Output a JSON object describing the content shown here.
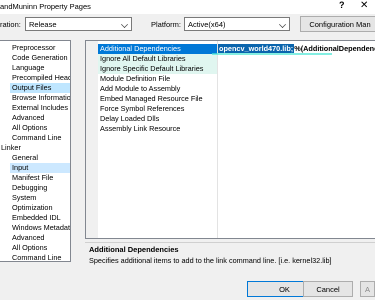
{
  "window": {
    "title": "andMuninn Property Pages",
    "help_label": "?",
    "close_label": "✕"
  },
  "config_bar": {
    "configuration_label": "ration:",
    "configuration_value": "Release",
    "platform_label": "Platform:",
    "platform_value": "Active(x64)",
    "config_manager_label": "Configuration Man"
  },
  "tree": {
    "items": [
      {
        "label": "Preprocessor"
      },
      {
        "label": "Code Generation"
      },
      {
        "label": "Language"
      },
      {
        "label": "Precompiled Heade"
      },
      {
        "label": "Output Files"
      },
      {
        "label": "Browse Information"
      },
      {
        "label": "External Includes"
      },
      {
        "label": "Advanced"
      },
      {
        "label": "All Options"
      },
      {
        "label": "Command Line"
      },
      {
        "label": "Linker"
      },
      {
        "label": "General"
      },
      {
        "label": "Input"
      },
      {
        "label": "Manifest File"
      },
      {
        "label": "Debugging"
      },
      {
        "label": "System"
      },
      {
        "label": "Optimization"
      },
      {
        "label": "Embedded IDL"
      },
      {
        "label": "Windows Metadata"
      },
      {
        "label": "Advanced"
      },
      {
        "label": "All Options"
      },
      {
        "label": "Command Line"
      }
    ]
  },
  "properties": {
    "rows": [
      {
        "name": "Additional Dependencies"
      },
      {
        "name": "Ignore All Default Libraries"
      },
      {
        "name": "Ignore Specific Default Libraries"
      },
      {
        "name": "Module Definition File"
      },
      {
        "name": "Add Module to Assembly"
      },
      {
        "name": "Embed Managed Resource File"
      },
      {
        "name": "Force Symbol References"
      },
      {
        "name": "Delay Loaded Dlls"
      },
      {
        "name": "Assembly Link Resource"
      }
    ],
    "selected_value_highlight": "opencv_world470.lib;",
    "selected_value_rest": "%(AdditionalDependencies)"
  },
  "description": {
    "title": "Additional Dependencies",
    "text": "Specifies additional items to add to the link command line. [i.e. kernel32.lib]"
  },
  "footer": {
    "ok_label": "OK",
    "cancel_label": "Cancel",
    "apply_label": "A"
  }
}
